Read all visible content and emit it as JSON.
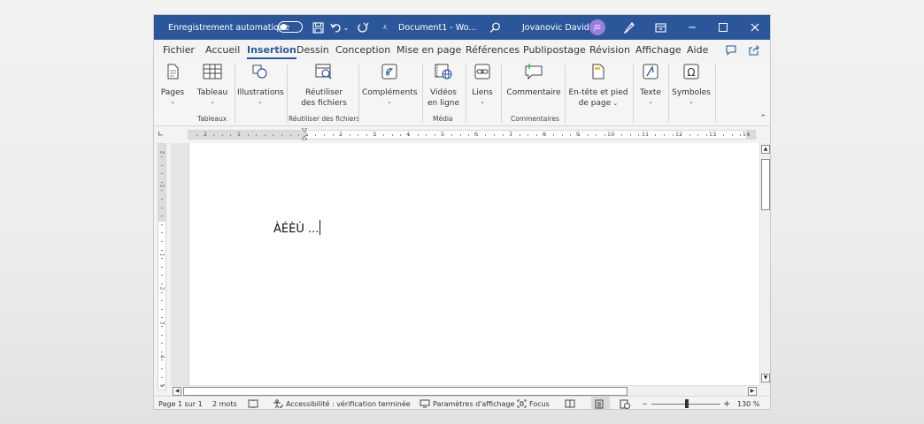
{
  "titlebar": {
    "autosave_label": "Enregistrement automatique",
    "doc_title": "Document1  -  Wo...",
    "user_name": "Jovanovic David",
    "user_initials": "JD"
  },
  "tabs": [
    "Fichier",
    "Accueil",
    "Insertion",
    "Dessin",
    "Conception",
    "Mise en page",
    "Références",
    "Publipostage",
    "Révision",
    "Affichage",
    "Aide"
  ],
  "active_tab": "Insertion",
  "ribbon": {
    "pages": "Pages",
    "tableau": "Tableau",
    "illustrations": "Illustrations",
    "reutiliser_1": "Réutiliser",
    "reutiliser_2": "des fichiers",
    "complements": "Compléments",
    "videos_1": "Vidéos",
    "videos_2": "en ligne",
    "liens": "Liens",
    "commentaire": "Commentaire",
    "entete_1": "En-tête et pied",
    "entete_2": "de page",
    "texte": "Texte",
    "symboles": "Symboles",
    "groups": {
      "tableaux": "Tableaux",
      "reutiliser": "Réutiliser des fichiers",
      "media": "Média",
      "commentaires": "Commentaires"
    }
  },
  "ruler": {
    "numbers": [
      "2",
      "1",
      "1",
      "2",
      "3",
      "4",
      "5",
      "6",
      "7",
      "8",
      "9",
      "10",
      "11",
      "12",
      "13",
      "14"
    ],
    "vnumbers": [
      "2",
      "1",
      "1",
      "2",
      "3",
      "4",
      "5"
    ]
  },
  "document": {
    "text": "ÀÉÈÙ ..."
  },
  "status": {
    "page": "Page 1 sur 1",
    "words": "2 mots",
    "accessibility": "Accessibilité : vérification terminée",
    "display_settings": "Paramètres d'affichage",
    "focus": "Focus",
    "zoom_minus": "–",
    "zoom_plus": "+",
    "zoom": "130 %"
  }
}
